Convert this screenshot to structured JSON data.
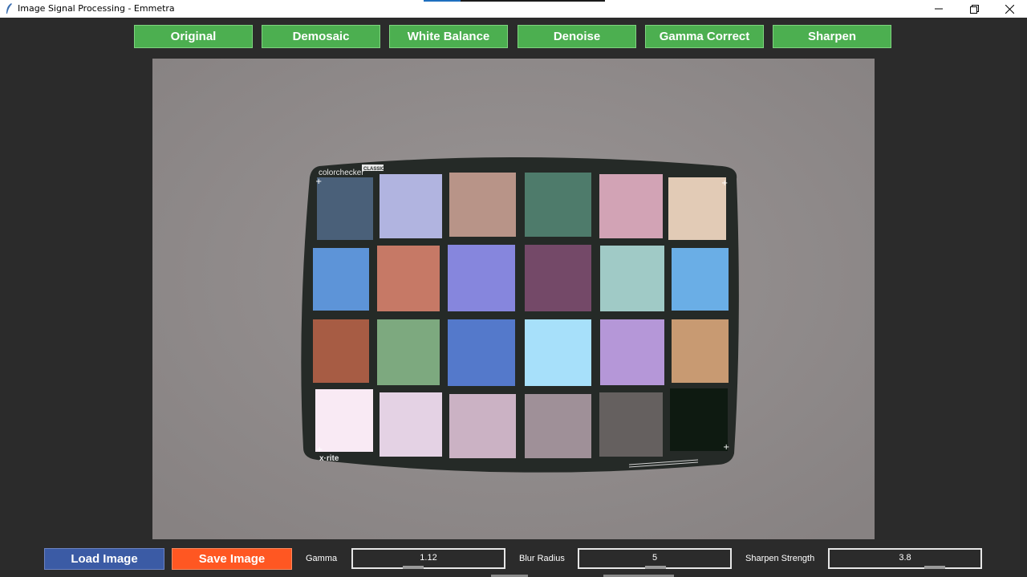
{
  "window": {
    "title": "Image Signal Processing - Emmetra",
    "controls": [
      "minimize-icon",
      "restore-icon",
      "close-icon"
    ]
  },
  "stages": [
    {
      "label": "Original"
    },
    {
      "label": "Demosaic"
    },
    {
      "label": "White Balance"
    },
    {
      "label": "Denoise"
    },
    {
      "label": "Gamma Correct"
    },
    {
      "label": "Sharpen"
    }
  ],
  "image": {
    "chart_brand": "colorchecker",
    "chart_variant": "CLASSIC",
    "maker": "x·rite"
  },
  "bottom": {
    "load_label": "Load Image",
    "save_label": "Save Image",
    "gamma_label": "Gamma",
    "gamma_value": "1.12",
    "blur_label": "Blur Radius",
    "blur_value": "5",
    "sharpen_label": "Sharpen Strength",
    "sharpen_value": "3.8"
  },
  "colors": {
    "stage_button": "#4caf50",
    "load_button": "#3b5ba5",
    "save_button": "#ff5722",
    "window_bg": "#2b2b2b"
  }
}
